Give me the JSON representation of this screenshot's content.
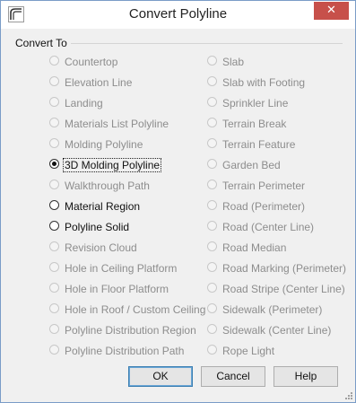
{
  "window": {
    "title": "Convert Polyline",
    "close_glyph": "✕",
    "app_icon": "chief-architect-icon"
  },
  "group": {
    "label": "Convert To"
  },
  "left_options": [
    {
      "label": "Countertop",
      "enabled": false,
      "selected": false
    },
    {
      "label": "Elevation Line",
      "enabled": false,
      "selected": false
    },
    {
      "label": "Landing",
      "enabled": false,
      "selected": false
    },
    {
      "label": "Materials List Polyline",
      "enabled": false,
      "selected": false
    },
    {
      "label": "Molding Polyline",
      "enabled": false,
      "selected": false
    },
    {
      "label": "3D Molding Polyline",
      "enabled": true,
      "selected": true
    },
    {
      "label": "Walkthrough Path",
      "enabled": false,
      "selected": false
    },
    {
      "label": "Material Region",
      "enabled": true,
      "selected": false
    },
    {
      "label": "Polyline Solid",
      "enabled": true,
      "selected": false
    },
    {
      "label": "Revision Cloud",
      "enabled": false,
      "selected": false
    },
    {
      "label": "Hole in Ceiling Platform",
      "enabled": false,
      "selected": false
    },
    {
      "label": "Hole in Floor Platform",
      "enabled": false,
      "selected": false
    },
    {
      "label": "Hole in Roof / Custom Ceiling",
      "enabled": false,
      "selected": false
    },
    {
      "label": "Polyline Distribution Region",
      "enabled": false,
      "selected": false
    },
    {
      "label": "Polyline Distribution Path",
      "enabled": false,
      "selected": false
    }
  ],
  "right_options": [
    {
      "label": "Slab",
      "enabled": false,
      "selected": false
    },
    {
      "label": "Slab with Footing",
      "enabled": false,
      "selected": false
    },
    {
      "label": "Sprinkler Line",
      "enabled": false,
      "selected": false
    },
    {
      "label": "Terrain Break",
      "enabled": false,
      "selected": false
    },
    {
      "label": "Terrain Feature",
      "enabled": false,
      "selected": false
    },
    {
      "label": "Garden Bed",
      "enabled": false,
      "selected": false
    },
    {
      "label": "Terrain Perimeter",
      "enabled": false,
      "selected": false
    },
    {
      "label": "Road (Perimeter)",
      "enabled": false,
      "selected": false
    },
    {
      "label": "Road (Center Line)",
      "enabled": false,
      "selected": false
    },
    {
      "label": "Road Median",
      "enabled": false,
      "selected": false
    },
    {
      "label": "Road Marking (Perimeter)",
      "enabled": false,
      "selected": false
    },
    {
      "label": "Road Stripe (Center Line)",
      "enabled": false,
      "selected": false
    },
    {
      "label": "Sidewalk (Perimeter)",
      "enabled": false,
      "selected": false
    },
    {
      "label": "Sidewalk (Center Line)",
      "enabled": false,
      "selected": false
    },
    {
      "label": "Rope Light",
      "enabled": false,
      "selected": false
    }
  ],
  "buttons": {
    "ok": "OK",
    "cancel": "Cancel",
    "help": "Help"
  },
  "colors": {
    "enabled_text": "#111111",
    "disabled_text": "#8d8d8d",
    "close_button": "#c7504a",
    "default_button_border": "#3c7fb1"
  }
}
